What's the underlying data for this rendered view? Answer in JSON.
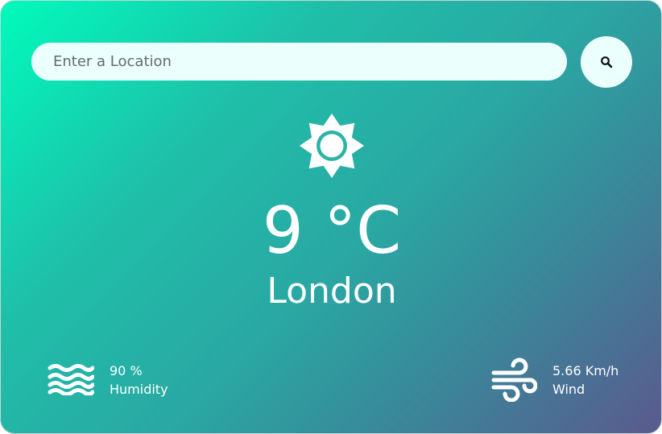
{
  "search": {
    "placeholder": "Enter a Location",
    "value": ""
  },
  "search_button": {
    "icon": "search-icon"
  },
  "weather": {
    "icon": "sun-icon",
    "temperature": "9 °C",
    "city": "London"
  },
  "humidity": {
    "icon": "waves-icon",
    "value": "90 %",
    "label": "Humidity"
  },
  "wind": {
    "icon": "wind-icon",
    "value": "5.66 Km/h",
    "label": "Wind"
  },
  "colors": {
    "gradient_start": "#00fbbc",
    "gradient_end": "#5a5a8e",
    "input_background": "#ebfffc",
    "text": "#ffffff"
  }
}
